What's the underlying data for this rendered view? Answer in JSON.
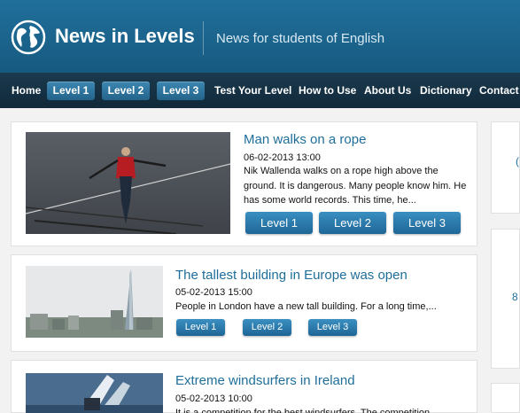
{
  "header": {
    "title": "News in Levels",
    "tagline": "News for students of English",
    "logo_icon": "globe-icon",
    "colors": {
      "header_bg": "#1f6f9b",
      "nav_bg": "#163246",
      "link": "#1f6e9a",
      "button": "#2a7aaa"
    }
  },
  "nav": {
    "home": "Home",
    "level1": "Level 1",
    "level2": "Level 2",
    "level3": "Level 3",
    "test": "Test Your Level",
    "how": "How to Use",
    "about": "About Us",
    "dictionary": "Dictionary",
    "contact": "Contact"
  },
  "articles": [
    {
      "title": "Man walks on a rope",
      "date": "06-02-2013 13:00",
      "text": "Nik Wallenda walks on a rope high above the ground. It is dangerous. Many people know him. He has some world records. This time, he...",
      "buttons": [
        "Level 1",
        "Level 2",
        "Level 3"
      ]
    },
    {
      "title": "The tallest building in Europe was open",
      "date": "05-02-2013 15:00",
      "text": "People in London have a new tall building. For a long time,...",
      "buttons": [
        "Level 1",
        "Level 2",
        "Level 3"
      ]
    },
    {
      "title": "Extreme windsurfers in Ireland",
      "date": "05-02-2013 10:00",
      "text": "It is a competition for the best windsurfers. The competition..."
    }
  ],
  "sidebar": {
    "fragment_1": "(",
    "fragment_2": "8"
  }
}
